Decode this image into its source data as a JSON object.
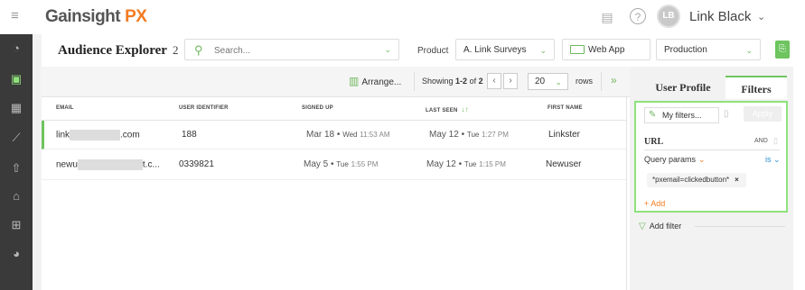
{
  "app": {
    "logo_main": "Gainsight",
    "logo_accent": "PX",
    "user_initials": "LB",
    "user_name": "Link Black"
  },
  "header": {
    "title": "Audience Explorer",
    "count": "2",
    "search_placeholder": "Search...",
    "product_label": "Product",
    "product_value": "A. Link Surveys",
    "app_value": "Web App",
    "env_value": "Production"
  },
  "toolbar": {
    "arrange_label": "Arrange...",
    "showing_prefix": "Showing",
    "showing_range": "1-2",
    "showing_of": "of",
    "showing_total": "2",
    "rows_value": "20",
    "rows_label": "rows"
  },
  "table": {
    "columns": [
      "EMAIL",
      "USER IDENTIFIER",
      "SIGNED UP",
      "LAST SEEN",
      "FIRST NAME"
    ],
    "rows": [
      {
        "email_start": "link",
        "email_end": ".com",
        "user_id": "188",
        "signed_up_date": "Mar 18",
        "signed_up_dow": "Wed",
        "signed_up_time": "11:53 AM",
        "last_seen_date": "May 12",
        "last_seen_dow": "Tue",
        "last_seen_time": "1:27 PM",
        "first_name": "Linkster"
      },
      {
        "email_start": "newu",
        "email_end": "t.c...",
        "user_id": "0339821",
        "signed_up_date": "May 5",
        "signed_up_dow": "Tue",
        "signed_up_time": "1:55 PM",
        "last_seen_date": "May 12",
        "last_seen_dow": "Tue",
        "last_seen_time": "1:15 PM",
        "first_name": "Newuser"
      }
    ]
  },
  "panel": {
    "tab_profile": "User Profile",
    "tab_filters": "Filters",
    "my_filters": "My filters...",
    "apply": "Apply",
    "url_label": "URL",
    "and_label": "AND",
    "query_params": "Query params",
    "is_label": "is",
    "chip_value": "*pxemail=clickedbutton*",
    "add_label": "+ Add",
    "add_filter": "Add filter"
  },
  "colors": {
    "accent_green": "#6ec45f",
    "brand_orange": "#f47b20",
    "nav_dark": "#3a3a3a",
    "link_blue": "#2d8fd5"
  }
}
